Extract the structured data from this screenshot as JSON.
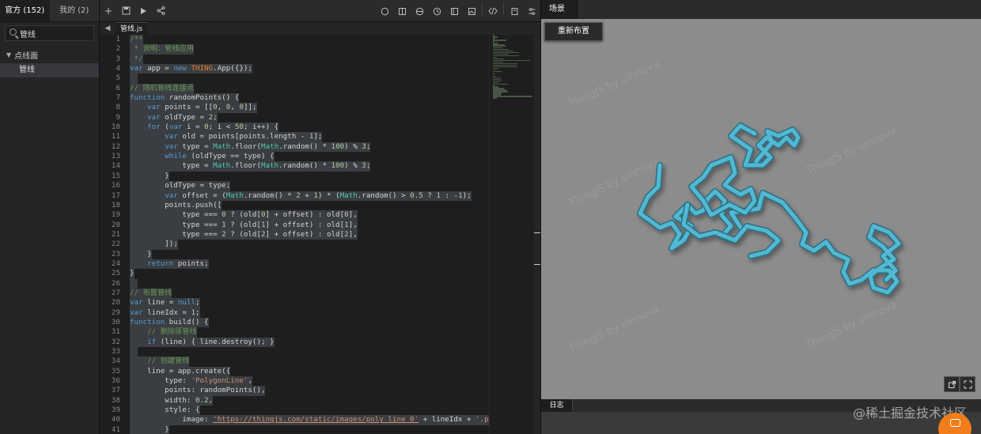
{
  "sidebar": {
    "tabs": [
      {
        "label": "官方 (152)"
      },
      {
        "label": "我的 (2)"
      }
    ],
    "search_value": "管线",
    "group_label": "点线面",
    "item_label": "管线"
  },
  "editor": {
    "file_tab": "管线.js",
    "toolbar_icons": [
      "plus-icon",
      "save-icon",
      "run-icon",
      "share-icon",
      "cube-icon",
      "book-icon",
      "globe-icon",
      "clock-icon",
      "layout-icon",
      "image-icon",
      "code-icon",
      "doc-icon",
      "settings-icon"
    ],
    "lines": [
      "/**",
      " * 说明：管线应用",
      " */",
      "var app = new THING.App({});",
      "",
      "// 随机管线连接点",
      "function randomPoints() {",
      "    var points = [[0, 0, 0]];",
      "    var oldType = 2;",
      "    for (var i = 0; i < 50; i++) {",
      "        var old = points[points.length - 1];",
      "        var type = Math.floor(Math.random() * 100) % 3;",
      "        while (oldType == type) {",
      "            type = Math.floor(Math.random() * 100) % 3;",
      "        }",
      "        oldType = type;",
      "        var offset = (Math.random() * 2 + 1) * (Math.random() > 0.5 ? 1 : -1);",
      "        points.push([",
      "            type === 0 ? (old[0] + offset) : old[0],",
      "            type === 1 ? (old[1] + offset) : old[1],",
      "            type === 2 ? (old[2] + offset) : old[2],",
      "        ]);",
      "    }",
      "    return points;",
      "}",
      "",
      "// 布置管线",
      "var line = null;",
      "var lineIdx = 1;",
      "function build() {",
      "    // 删除原管线",
      "    if (line) { line.destroy(); }",
      "",
      "    // 创建管线",
      "    line = app.create({",
      "        type: 'PolygonLine',",
      "        points: randomPoints(),",
      "        width: 0.2,",
      "        style: {",
      "            image: 'https://thingjs.com/static/images/poly_line_0' + lineIdx + '.png',",
      "        }"
    ]
  },
  "scene": {
    "title": "场景",
    "relayout_label": "重新布置",
    "watermark": "ThingJS by uinnova",
    "log_tab": "日志",
    "footer_text": "@稀土掘金技术社区"
  }
}
